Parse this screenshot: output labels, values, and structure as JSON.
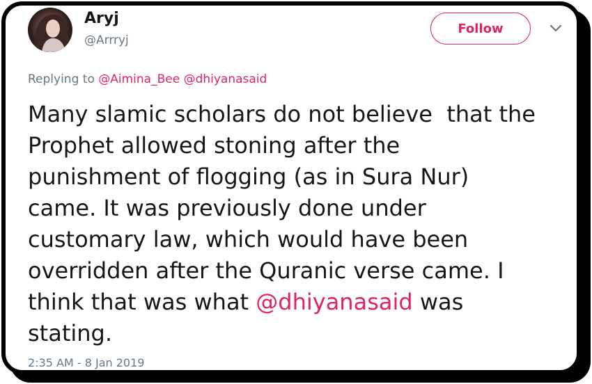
{
  "user": {
    "name": "Aryj",
    "handle": "@Arrryj"
  },
  "follow_label": "Follow",
  "reply": {
    "prefix": "Replying to ",
    "mentions": [
      "@Aimina_Bee",
      "@dhiyanasaid"
    ]
  },
  "tweet": {
    "text_before": "Many slamic scholars do not believe  that the\nProphet allowed stoning after the\npunishment of flogging (as in Sura Nur)\ncame. It was previously done under\ncustomary law, which would have been\noverridden after the Quranic verse came. I\nthink that was what ",
    "mention": "@dhiyanasaid",
    "text_after": " was\nstating."
  },
  "timestamp": "2:35 AM - 8 Jan 2019",
  "colors": {
    "accent": "#e0245e",
    "text": "#14171a",
    "secondary": "#657786"
  },
  "icons": {
    "avatar": "profile-photo",
    "menu": "chevron-down-icon"
  }
}
